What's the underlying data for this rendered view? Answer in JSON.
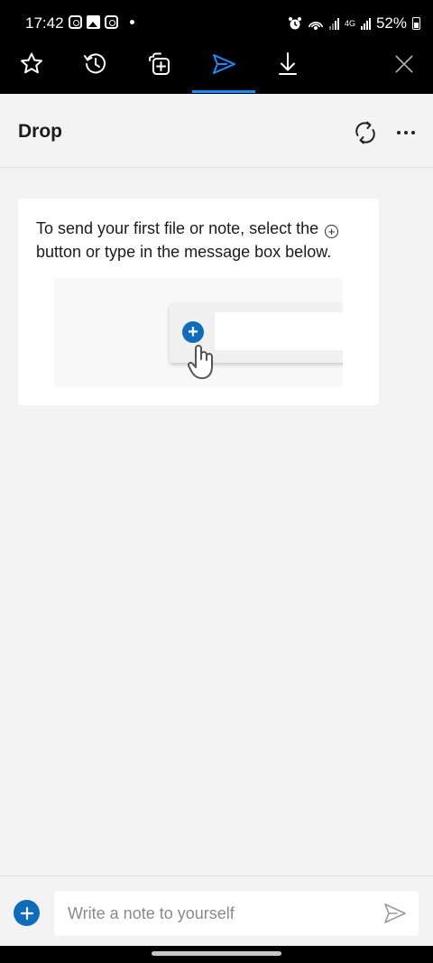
{
  "status_bar": {
    "time": "17:42",
    "network": "4G",
    "battery": "52%"
  },
  "toolbar": {
    "items": [
      {
        "name": "favorites",
        "icon": "star-icon",
        "active": false
      },
      {
        "name": "history",
        "icon": "history-icon",
        "active": false
      },
      {
        "name": "collections",
        "icon": "collections-icon",
        "active": false
      },
      {
        "name": "drop",
        "icon": "send-icon",
        "active": true
      },
      {
        "name": "downloads",
        "icon": "download-icon",
        "active": false
      }
    ],
    "active_color": "#1a8cff"
  },
  "header": {
    "title": "Drop"
  },
  "onboarding": {
    "text_before_icon": "To send your first file or note, select the",
    "text_after_icon": "button or type in the message box below."
  },
  "composer": {
    "placeholder": "Write a note to yourself",
    "accent_color": "#0f6cbd"
  }
}
